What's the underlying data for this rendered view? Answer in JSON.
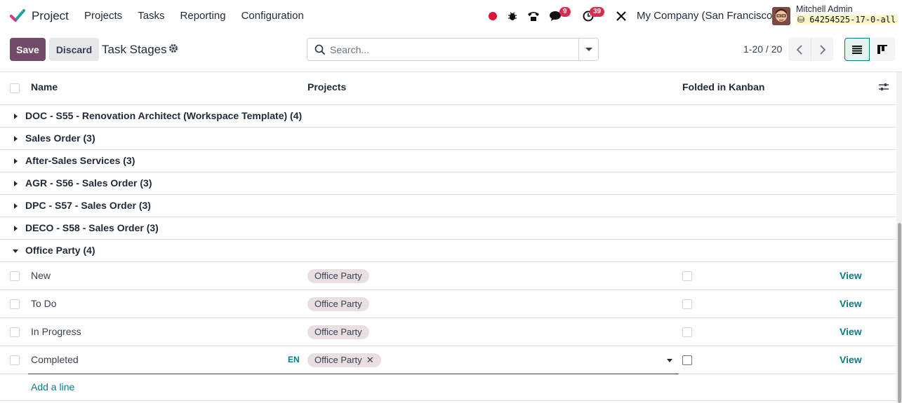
{
  "navbar": {
    "app_name": "Project",
    "menu": [
      "Projects",
      "Tasks",
      "Reporting",
      "Configuration"
    ],
    "messages_count": "9",
    "activities_count": "39",
    "company": "My Company (San Francisco)",
    "user_name": "Mitchell Admin",
    "database": "64254525-17-0-all"
  },
  "control_panel": {
    "save_label": "Save",
    "discard_label": "Discard",
    "title": "Task Stages",
    "search_placeholder": "Search...",
    "pager": "1-20 / 20"
  },
  "table": {
    "columns": [
      "Name",
      "Projects",
      "Folded in Kanban"
    ],
    "groups": [
      {
        "label": "DOC - S55 - Renovation Architect (Workspace Template) (4)",
        "expanded": false
      },
      {
        "label": "Sales Order (3)",
        "expanded": false
      },
      {
        "label": "After-Sales Services (3)",
        "expanded": false
      },
      {
        "label": "AGR - S56 - Sales Order (3)",
        "expanded": false
      },
      {
        "label": "DPC - S57 - Sales Order (3)",
        "expanded": false
      },
      {
        "label": "DECO - S58 - Sales Order (3)",
        "expanded": false
      },
      {
        "label": "Office Party (4)",
        "expanded": true
      }
    ],
    "rows": [
      {
        "name": "New",
        "project": "Office Party",
        "action": "View"
      },
      {
        "name": "To Do",
        "project": "Office Party",
        "action": "View"
      },
      {
        "name": "In Progress",
        "project": "Office Party",
        "action": "View"
      },
      {
        "name": "Completed",
        "project": "Office Party",
        "action": "View",
        "lang": "EN",
        "editing": true
      }
    ],
    "add_line_label": "Add a line"
  },
  "colors": {
    "brand": "#714b67",
    "accent": "#017e84",
    "badge": "#dc2a4b"
  }
}
